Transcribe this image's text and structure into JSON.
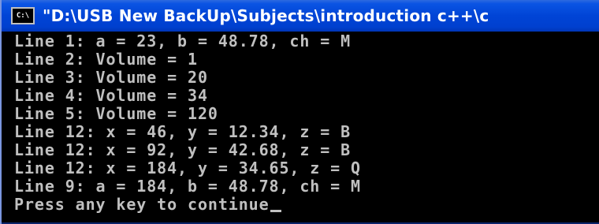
{
  "window": {
    "icon_text": "C:\\",
    "title": "\"D:\\USB New BackUp\\Subjects\\introduction c++\\c"
  },
  "console": {
    "lines": [
      "Line 1: a = 23, b = 48.78, ch = M",
      "Line 2: Volume = 1",
      "Line 3: Volume = 20",
      "Line 4: Volume = 34",
      "Line 5: Volume = 120",
      "Line 12: x = 46, y = 12.34, z = B",
      "Line 12: x = 92, y = 42.68, z = B",
      "Line 12: x = 184, y = 34.65, z = Q",
      "Line 9: a = 184, b = 48.78, ch = M",
      "Press any key to continue"
    ]
  },
  "colors": {
    "console_background": "#000000",
    "console_text": "#c0c0c0",
    "titlebar": "#0044d6",
    "title_text": "#ffffff"
  }
}
